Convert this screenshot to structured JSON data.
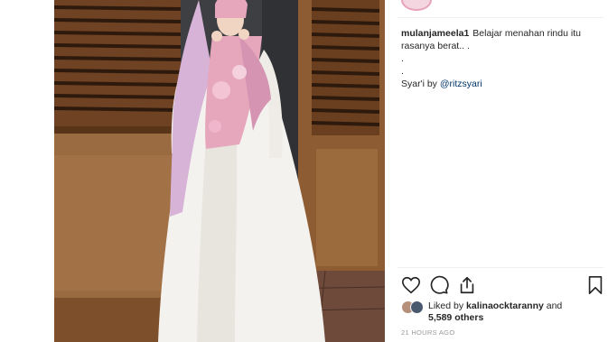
{
  "post": {
    "username": "mulanjameela1",
    "caption_line1": "Belajar menahan rindu itu",
    "caption_line2": "rasanya berat.. .",
    "caption_dot1": ".",
    "caption_dot2": ".",
    "credit_prefix": "Syar'i by ",
    "credit_mention": "@ritzsyari"
  },
  "likes": {
    "prefix": "Liked by ",
    "liker": "kalinaocktaranny",
    "conjunction": " and",
    "others": "5,589 others"
  },
  "timestamp": "21 HOURS AGO",
  "icons": {
    "like": "heart-icon",
    "comment": "comment-icon",
    "share": "share-icon",
    "save": "bookmark-icon"
  },
  "colors": {
    "mention": "#003569",
    "meta": "#999999",
    "text": "#262626"
  }
}
